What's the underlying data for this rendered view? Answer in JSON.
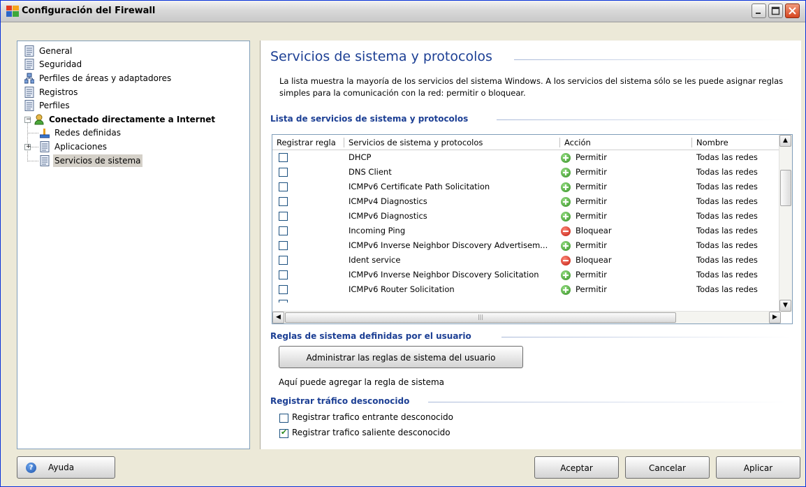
{
  "window": {
    "title": "Configuración del Firewall"
  },
  "tree": [
    {
      "label": "General",
      "icon": "document-icon"
    },
    {
      "label": "Seguridad",
      "icon": "document-icon"
    },
    {
      "label": "Perfiles de áreas y adaptadores",
      "icon": "network-icon"
    },
    {
      "label": "Registros",
      "icon": "document-icon"
    },
    {
      "label": "Perfiles",
      "icon": "document-icon"
    },
    {
      "label": "Conectado directamente a Internet",
      "icon": "user-icon"
    },
    {
      "label": "Redes definidas",
      "icon": "network-icon"
    },
    {
      "label": "Aplicaciones",
      "icon": "document-icon"
    },
    {
      "label": "Servicios de sistema",
      "icon": "document-icon"
    }
  ],
  "main": {
    "title": "Servicios de sistema y protocolos",
    "description": "La lista muestra la mayoría de los servicios del sistema Windows. A los servicios del sistema sólo se les puede asignar reglas simples para la comunicación con la red: permitir o bloquear.",
    "list_section": "Lista de servicios de sistema y protocolos",
    "columns": [
      "Registrar regla",
      "Servicios de sistema y protocolos",
      "Acción",
      "Nombre"
    ],
    "rows": [
      {
        "service": "DHCP",
        "action": "Permitir",
        "type": "allow",
        "name": "Todas las redes"
      },
      {
        "service": "DNS Client",
        "action": "Permitir",
        "type": "allow",
        "name": "Todas las redes"
      },
      {
        "service": "ICMPv6 Certificate Path Solicitation",
        "action": "Permitir",
        "type": "allow",
        "name": "Todas las redes"
      },
      {
        "service": "ICMPv4 Diagnostics",
        "action": "Permitir",
        "type": "allow",
        "name": "Todas las redes"
      },
      {
        "service": "ICMPv6 Diagnostics",
        "action": "Permitir",
        "type": "allow",
        "name": "Todas las redes"
      },
      {
        "service": "Incoming Ping",
        "action": "Bloquear",
        "type": "block",
        "name": "Todas las redes"
      },
      {
        "service": "ICMPv6 Inverse Neighbor Discovery Advertisem...",
        "action": "Permitir",
        "type": "allow",
        "name": "Todas las redes"
      },
      {
        "service": "Ident service",
        "action": "Bloquear",
        "type": "block",
        "name": "Todas las redes"
      },
      {
        "service": "ICMPv6 Inverse Neighbor Discovery Solicitation",
        "action": "Permitir",
        "type": "allow",
        "name": "Todas las redes"
      },
      {
        "service": "ICMPv6 Router Solicitation",
        "action": "Permitir",
        "type": "allow",
        "name": "Todas las redes"
      }
    ],
    "user_rules_section": "Reglas de sistema definidas por el usuario",
    "manage_button": "Administrar las reglas de sistema del usuario",
    "manage_hint": "Aquí puede agregar la regla de sistema",
    "traffic_section": "Registrar tráfico desconocido",
    "incoming_label": "Registrar trafico entrante desconocido",
    "incoming_checked": false,
    "outgoing_label": "Registrar trafico saliente desconocido",
    "outgoing_checked": true
  },
  "footer": {
    "help": "Ayuda",
    "accept": "Aceptar",
    "cancel": "Cancelar",
    "apply": "Aplicar"
  },
  "colors": {
    "heading": "#1c3f94",
    "allow": "#2f8b1f",
    "block": "#c0180c"
  }
}
